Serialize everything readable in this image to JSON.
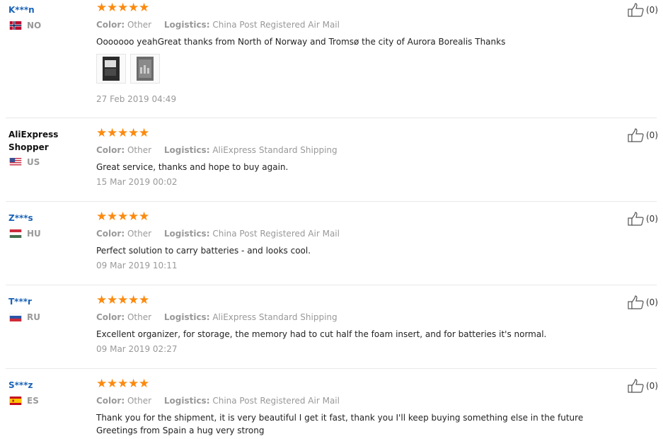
{
  "labels": {
    "color": "Color:",
    "logistics": "Logistics:"
  },
  "colors": {
    "star": "#fc8a0f",
    "name_link": "#1a63b8",
    "muted": "#999999"
  },
  "reviews": [
    {
      "name": "K***n",
      "country": "NO",
      "rating": 5,
      "color": "Other",
      "logistics": "China Post Registered Air Mail",
      "text": "Ooooooo yeahGreat thanks from North of Norway and Tromsø the city of Aurora Borealis Thanks",
      "has_images": true,
      "images": [
        "review-photo-1",
        "review-photo-2"
      ],
      "date": "27 Feb 2019 04:49",
      "helpful_count": "(0)"
    },
    {
      "name": "AliExpress Shopper",
      "country": "US",
      "rating": 5,
      "color": "Other",
      "logistics": "AliExpress Standard Shipping",
      "text": "Great service, thanks and hope to buy again.",
      "date": "15 Mar 2019 00:02",
      "helpful_count": "(0)"
    },
    {
      "name": "Z***s",
      "country": "HU",
      "rating": 5,
      "color": "Other",
      "logistics": "China Post Registered Air Mail",
      "text": "Perfect solution to carry batteries - and looks cool.",
      "date": "09 Mar 2019 10:11",
      "helpful_count": "(0)"
    },
    {
      "name": "T***r",
      "country": "RU",
      "rating": 5,
      "color": "Other",
      "logistics": "AliExpress Standard Shipping",
      "text": "Excellent organizer, for storage, the memory had to cut half the foam insert, and for batteries it's normal.",
      "date": "09 Mar 2019 02:27",
      "helpful_count": "(0)"
    },
    {
      "name": "S***z",
      "country": "ES",
      "rating": 5,
      "color": "Other",
      "logistics": "China Post Registered Air Mail",
      "text": "Thank you for the shipment, it is very beautiful I get it fast, thank you I'll keep buying something else in the future Greetings from Spain a hug very strong",
      "date": "",
      "helpful_count": "(0)"
    }
  ]
}
